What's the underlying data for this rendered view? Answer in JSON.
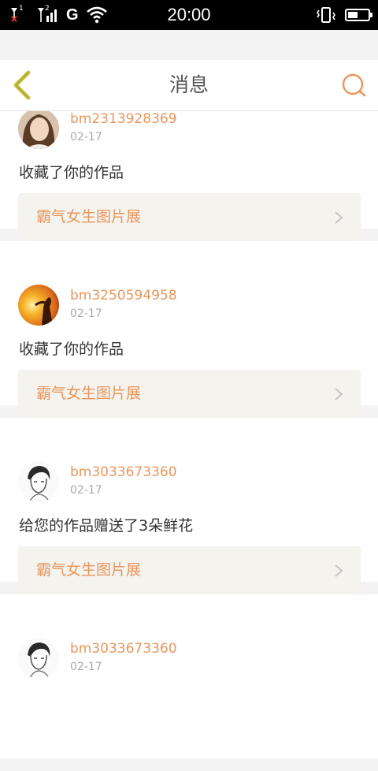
{
  "status_bar": {
    "time": "20:00",
    "network_label": "G",
    "sim1_label": "1",
    "sim2_label": "2",
    "battery_level": 0.5
  },
  "nav": {
    "title": "消息",
    "back_icon": "chevron-left-icon",
    "search_icon": "search-icon",
    "accent_color": "#e8965d",
    "back_color": "#c9bf3a"
  },
  "messages": [
    {
      "username": "bm2313928369",
      "date": "02-17",
      "action": "收藏了你的作品",
      "album": "霸气女生图片展"
    },
    {
      "username": "bm3250594958",
      "date": "02-17",
      "action": "收藏了你的作品",
      "album": "霸气女生图片展"
    },
    {
      "username": "bm3033673360",
      "date": "02-17",
      "action": "给您的作品赠送了3朵鲜花",
      "album": "霸气女生图片展"
    },
    {
      "username": "bm3033673360",
      "date": "02-17",
      "action": "",
      "album": ""
    }
  ]
}
